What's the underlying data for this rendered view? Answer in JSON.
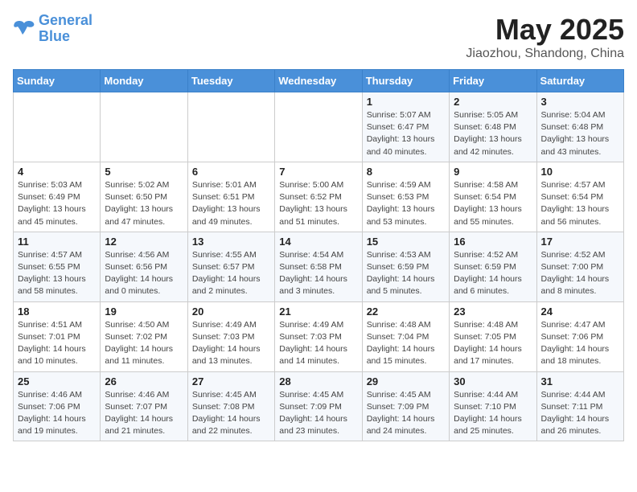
{
  "logo": {
    "line1": "General",
    "line2": "Blue"
  },
  "title": "May 2025",
  "subtitle": "Jiaozhou, Shandong, China",
  "days_of_week": [
    "Sunday",
    "Monday",
    "Tuesday",
    "Wednesday",
    "Thursday",
    "Friday",
    "Saturday"
  ],
  "weeks": [
    [
      {
        "day": "",
        "info": ""
      },
      {
        "day": "",
        "info": ""
      },
      {
        "day": "",
        "info": ""
      },
      {
        "day": "",
        "info": ""
      },
      {
        "day": "1",
        "info": "Sunrise: 5:07 AM\nSunset: 6:47 PM\nDaylight: 13 hours\nand 40 minutes."
      },
      {
        "day": "2",
        "info": "Sunrise: 5:05 AM\nSunset: 6:48 PM\nDaylight: 13 hours\nand 42 minutes."
      },
      {
        "day": "3",
        "info": "Sunrise: 5:04 AM\nSunset: 6:48 PM\nDaylight: 13 hours\nand 43 minutes."
      }
    ],
    [
      {
        "day": "4",
        "info": "Sunrise: 5:03 AM\nSunset: 6:49 PM\nDaylight: 13 hours\nand 45 minutes."
      },
      {
        "day": "5",
        "info": "Sunrise: 5:02 AM\nSunset: 6:50 PM\nDaylight: 13 hours\nand 47 minutes."
      },
      {
        "day": "6",
        "info": "Sunrise: 5:01 AM\nSunset: 6:51 PM\nDaylight: 13 hours\nand 49 minutes."
      },
      {
        "day": "7",
        "info": "Sunrise: 5:00 AM\nSunset: 6:52 PM\nDaylight: 13 hours\nand 51 minutes."
      },
      {
        "day": "8",
        "info": "Sunrise: 4:59 AM\nSunset: 6:53 PM\nDaylight: 13 hours\nand 53 minutes."
      },
      {
        "day": "9",
        "info": "Sunrise: 4:58 AM\nSunset: 6:54 PM\nDaylight: 13 hours\nand 55 minutes."
      },
      {
        "day": "10",
        "info": "Sunrise: 4:57 AM\nSunset: 6:54 PM\nDaylight: 13 hours\nand 56 minutes."
      }
    ],
    [
      {
        "day": "11",
        "info": "Sunrise: 4:57 AM\nSunset: 6:55 PM\nDaylight: 13 hours\nand 58 minutes."
      },
      {
        "day": "12",
        "info": "Sunrise: 4:56 AM\nSunset: 6:56 PM\nDaylight: 14 hours\nand 0 minutes."
      },
      {
        "day": "13",
        "info": "Sunrise: 4:55 AM\nSunset: 6:57 PM\nDaylight: 14 hours\nand 2 minutes."
      },
      {
        "day": "14",
        "info": "Sunrise: 4:54 AM\nSunset: 6:58 PM\nDaylight: 14 hours\nand 3 minutes."
      },
      {
        "day": "15",
        "info": "Sunrise: 4:53 AM\nSunset: 6:59 PM\nDaylight: 14 hours\nand 5 minutes."
      },
      {
        "day": "16",
        "info": "Sunrise: 4:52 AM\nSunset: 6:59 PM\nDaylight: 14 hours\nand 6 minutes."
      },
      {
        "day": "17",
        "info": "Sunrise: 4:52 AM\nSunset: 7:00 PM\nDaylight: 14 hours\nand 8 minutes."
      }
    ],
    [
      {
        "day": "18",
        "info": "Sunrise: 4:51 AM\nSunset: 7:01 PM\nDaylight: 14 hours\nand 10 minutes."
      },
      {
        "day": "19",
        "info": "Sunrise: 4:50 AM\nSunset: 7:02 PM\nDaylight: 14 hours\nand 11 minutes."
      },
      {
        "day": "20",
        "info": "Sunrise: 4:49 AM\nSunset: 7:03 PM\nDaylight: 14 hours\nand 13 minutes."
      },
      {
        "day": "21",
        "info": "Sunrise: 4:49 AM\nSunset: 7:03 PM\nDaylight: 14 hours\nand 14 minutes."
      },
      {
        "day": "22",
        "info": "Sunrise: 4:48 AM\nSunset: 7:04 PM\nDaylight: 14 hours\nand 15 minutes."
      },
      {
        "day": "23",
        "info": "Sunrise: 4:48 AM\nSunset: 7:05 PM\nDaylight: 14 hours\nand 17 minutes."
      },
      {
        "day": "24",
        "info": "Sunrise: 4:47 AM\nSunset: 7:06 PM\nDaylight: 14 hours\nand 18 minutes."
      }
    ],
    [
      {
        "day": "25",
        "info": "Sunrise: 4:46 AM\nSunset: 7:06 PM\nDaylight: 14 hours\nand 19 minutes."
      },
      {
        "day": "26",
        "info": "Sunrise: 4:46 AM\nSunset: 7:07 PM\nDaylight: 14 hours\nand 21 minutes."
      },
      {
        "day": "27",
        "info": "Sunrise: 4:45 AM\nSunset: 7:08 PM\nDaylight: 14 hours\nand 22 minutes."
      },
      {
        "day": "28",
        "info": "Sunrise: 4:45 AM\nSunset: 7:09 PM\nDaylight: 14 hours\nand 23 minutes."
      },
      {
        "day": "29",
        "info": "Sunrise: 4:45 AM\nSunset: 7:09 PM\nDaylight: 14 hours\nand 24 minutes."
      },
      {
        "day": "30",
        "info": "Sunrise: 4:44 AM\nSunset: 7:10 PM\nDaylight: 14 hours\nand 25 minutes."
      },
      {
        "day": "31",
        "info": "Sunrise: 4:44 AM\nSunset: 7:11 PM\nDaylight: 14 hours\nand 26 minutes."
      }
    ]
  ]
}
